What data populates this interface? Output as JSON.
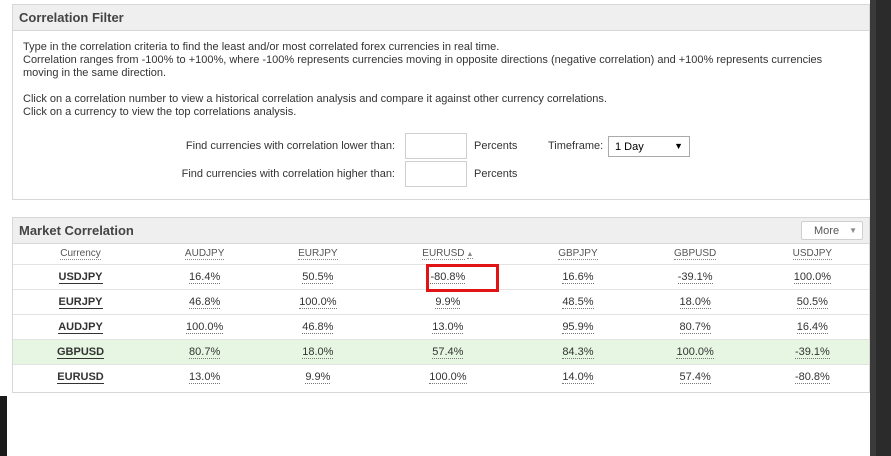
{
  "filter": {
    "title": "Correlation Filter",
    "line1": "Type in the correlation criteria to find the least and/or most correlated forex currencies in real time.",
    "line2": "Correlation ranges from -100% to +100%, where -100% represents currencies moving in opposite directions (negative correlation) and +100% represents currencies",
    "line3": "moving in the same direction.",
    "line4": "Click on a correlation number to view a historical correlation analysis and compare it against other currency correlations.",
    "line5": "Click on a currency to view the top correlations analysis.",
    "lower_label": "Find currencies with correlation lower than:",
    "higher_label": "Find currencies with correlation higher than:",
    "lower_value": "",
    "higher_value": "",
    "unit": "Percents",
    "timeframe_label": "Timeframe:",
    "timeframe_value": "1 Day"
  },
  "market": {
    "title": "Market Correlation",
    "more_label": "More",
    "headers": [
      "Currency",
      "AUDJPY",
      "EURJPY",
      "EURUSD",
      "GBPJPY",
      "GBPUSD",
      "USDJPY"
    ],
    "sorted_column": "EURUSD",
    "rows": [
      {
        "currency": "USDJPY",
        "values": [
          "16.4%",
          "50.5%",
          "-80.8%",
          "16.6%",
          "-39.1%",
          "100.0%"
        ]
      },
      {
        "currency": "EURJPY",
        "values": [
          "46.8%",
          "100.0%",
          "9.9%",
          "48.5%",
          "18.0%",
          "50.5%"
        ]
      },
      {
        "currency": "AUDJPY",
        "values": [
          "100.0%",
          "46.8%",
          "13.0%",
          "95.9%",
          "80.7%",
          "16.4%"
        ]
      },
      {
        "currency": "GBPUSD",
        "values": [
          "80.7%",
          "18.0%",
          "57.4%",
          "84.3%",
          "100.0%",
          "-39.1%"
        ]
      },
      {
        "currency": "EURUSD",
        "values": [
          "13.0%",
          "9.9%",
          "100.0%",
          "14.0%",
          "57.4%",
          "-80.8%"
        ]
      }
    ],
    "highlight_row": "GBPUSD",
    "highlight_color": "#e6f6e2",
    "annotation_color": "#e01414"
  }
}
